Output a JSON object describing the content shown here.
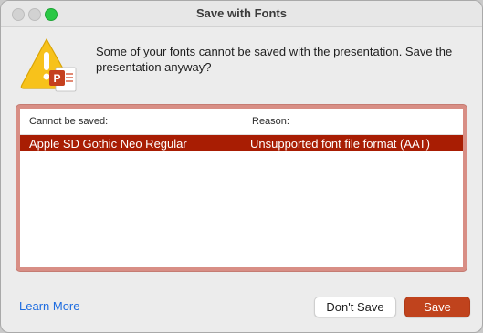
{
  "window": {
    "title": "Save with Fonts"
  },
  "message": "Some of your fonts cannot be saved with the presentation. Save the presentation anyway?",
  "table": {
    "headers": [
      "Cannot be saved:",
      "Reason:"
    ],
    "rows": [
      {
        "font": "Apple SD Gothic Neo Regular",
        "reason": "Unsupported font file format (AAT)"
      }
    ]
  },
  "footer": {
    "learn_more": "Learn More",
    "dont_save": "Don't Save",
    "save": "Save"
  },
  "icon": {
    "name": "warning-powerpoint-icon",
    "badge_letter": "P"
  },
  "colors": {
    "selection": "#a81d03",
    "table_border": "#d88e85",
    "save_button": "#c0431d",
    "link": "#1d6ce0",
    "warning": "#f7c21b"
  }
}
